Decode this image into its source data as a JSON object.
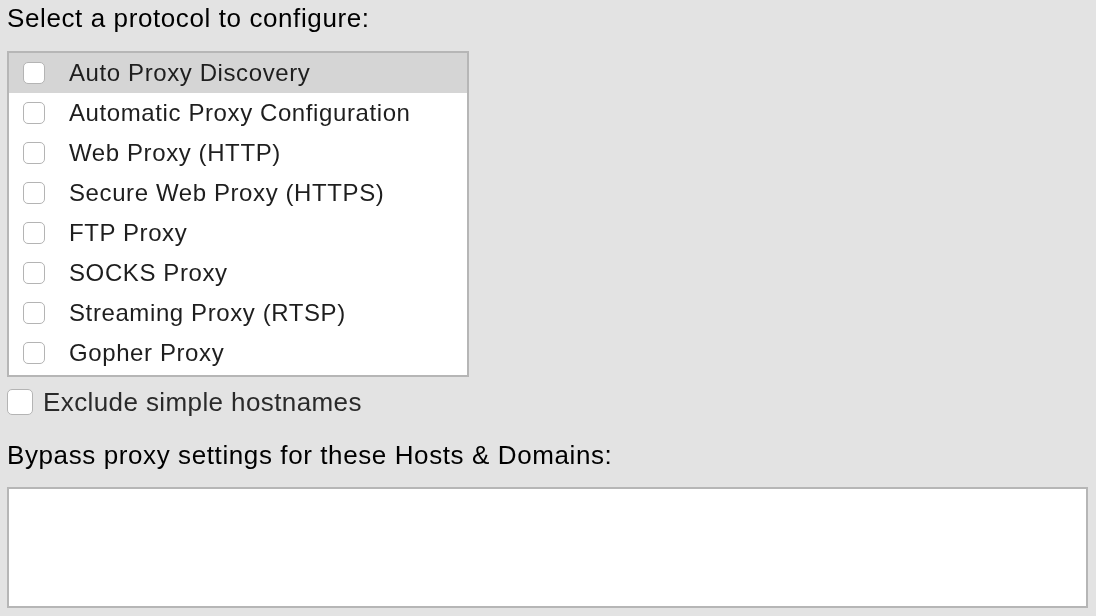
{
  "protocols": {
    "label": "Select a protocol to configure:",
    "items": [
      {
        "label": "Auto Proxy Discovery",
        "checked": false,
        "selected": true
      },
      {
        "label": "Automatic Proxy Configuration",
        "checked": false,
        "selected": false
      },
      {
        "label": "Web Proxy (HTTP)",
        "checked": false,
        "selected": false
      },
      {
        "label": "Secure Web Proxy (HTTPS)",
        "checked": false,
        "selected": false
      },
      {
        "label": "FTP Proxy",
        "checked": false,
        "selected": false
      },
      {
        "label": "SOCKS Proxy",
        "checked": false,
        "selected": false
      },
      {
        "label": "Streaming Proxy (RTSP)",
        "checked": false,
        "selected": false
      },
      {
        "label": "Gopher Proxy",
        "checked": false,
        "selected": false
      }
    ]
  },
  "exclude_simple_hostnames": {
    "label": "Exclude simple hostnames",
    "checked": false
  },
  "bypass": {
    "label": "Bypass proxy settings for these Hosts & Domains:"
  }
}
